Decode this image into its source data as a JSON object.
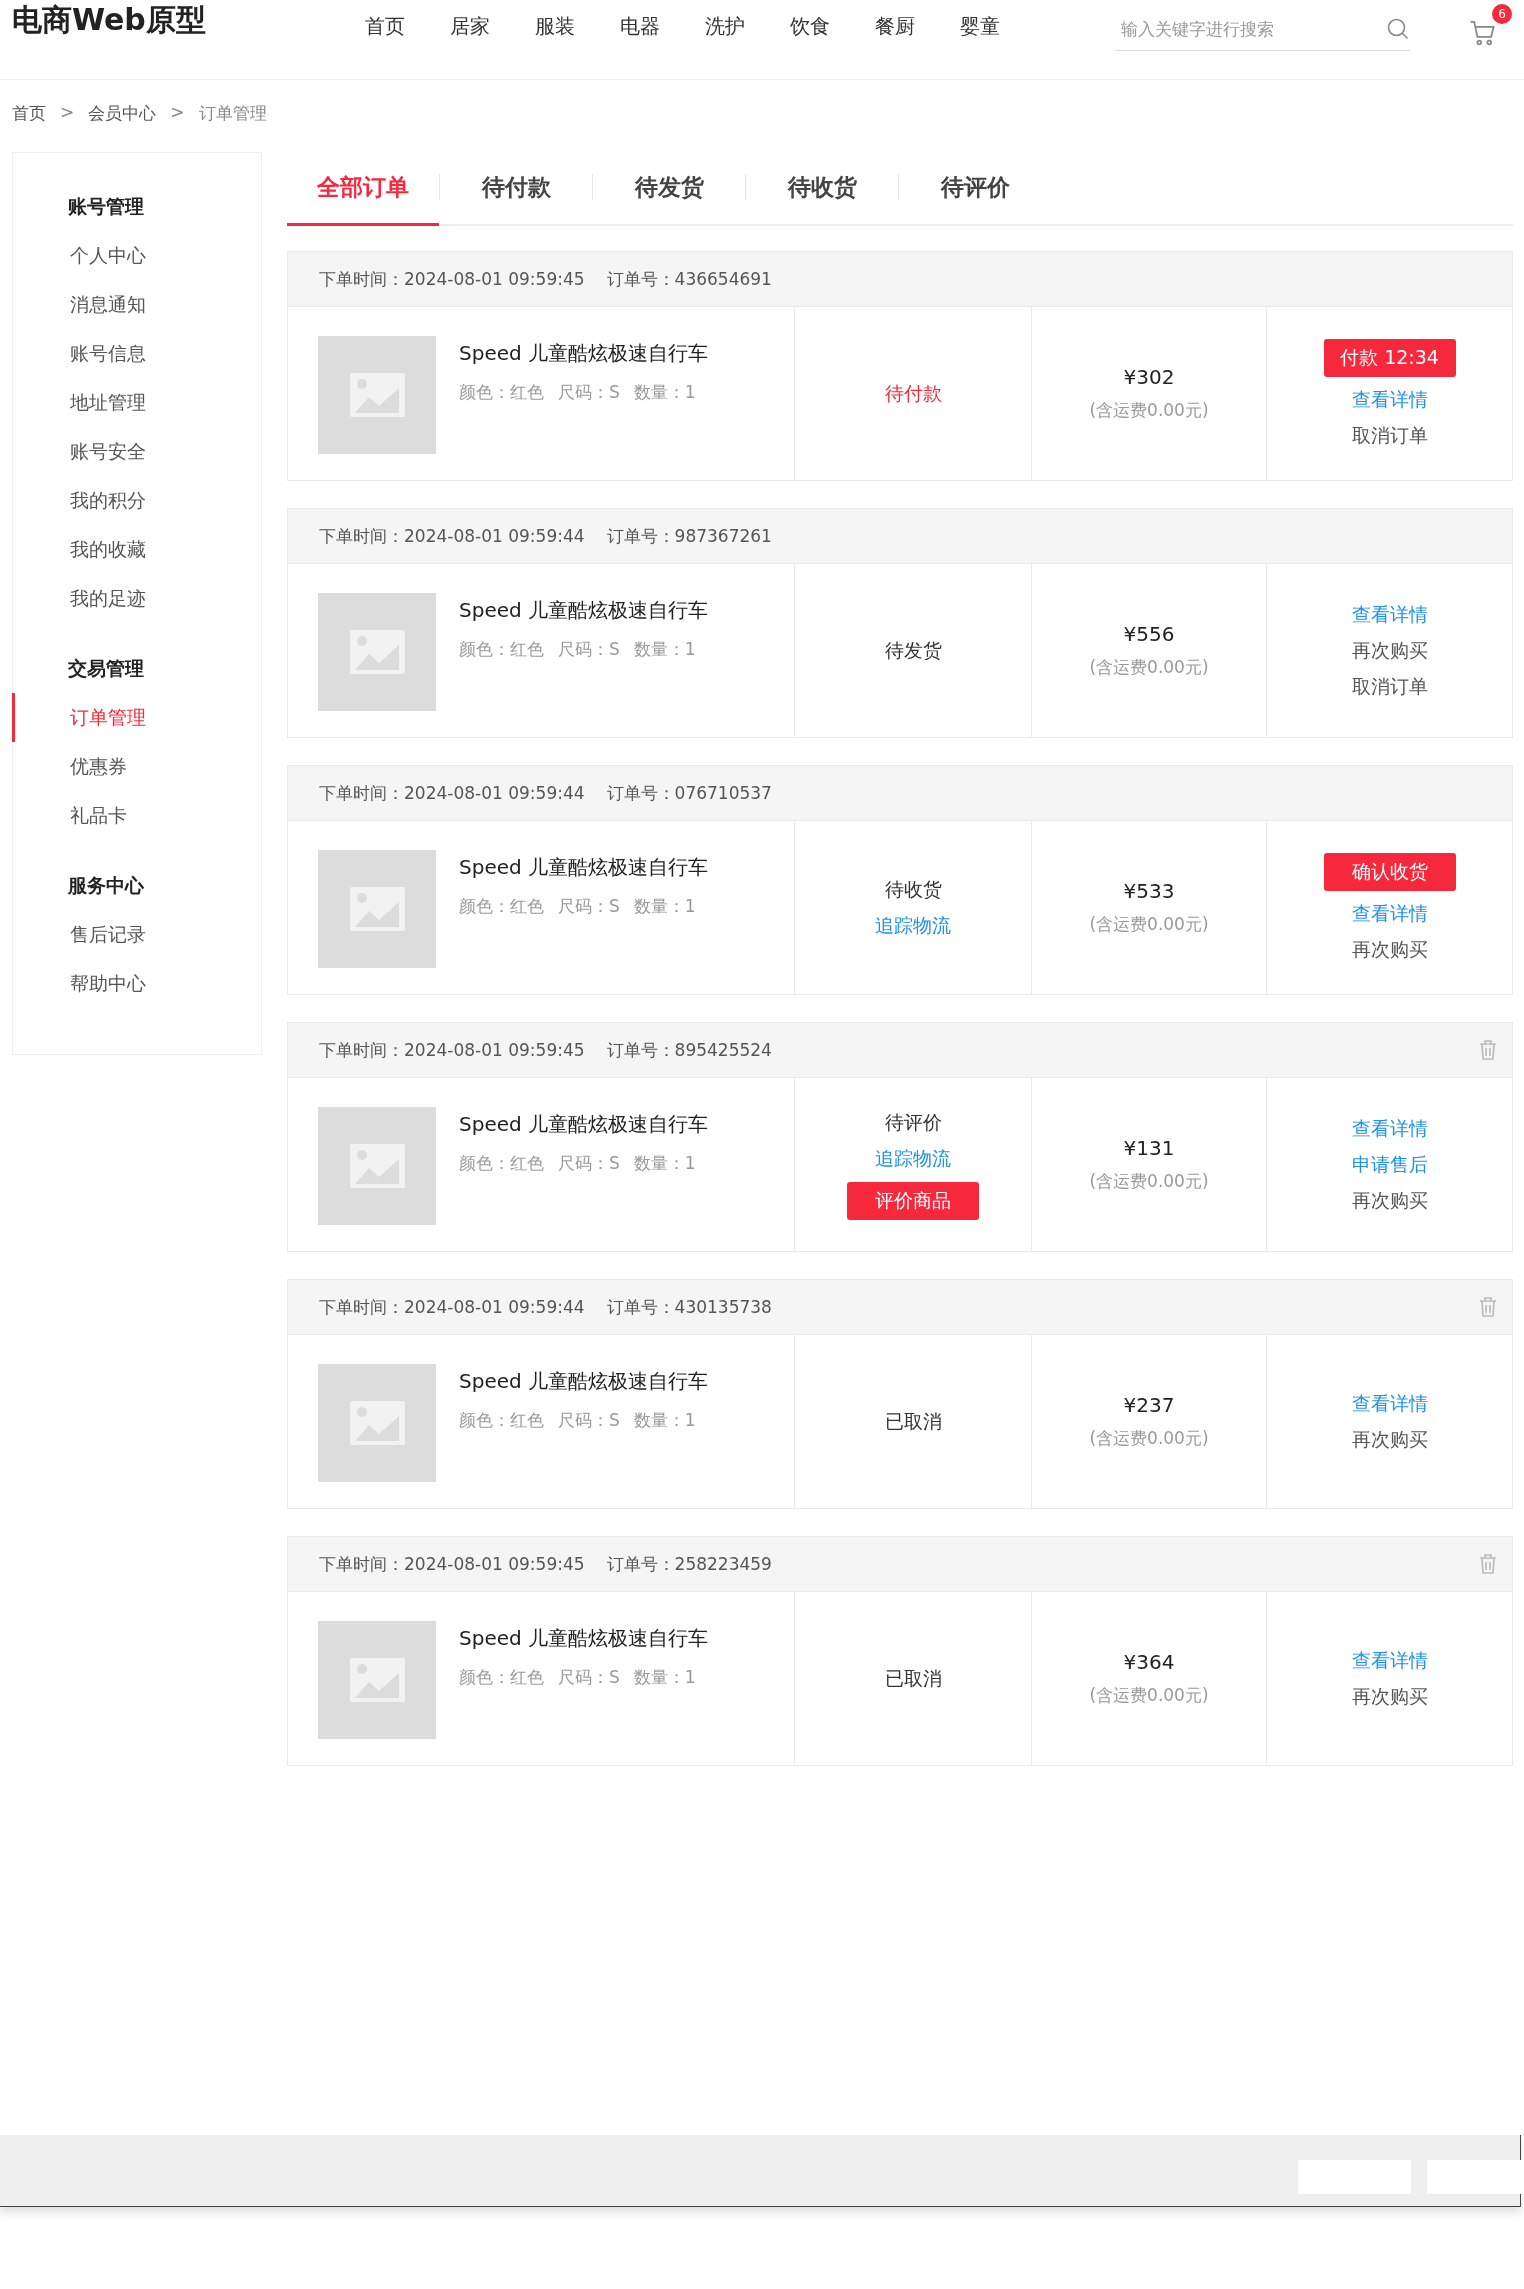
{
  "logo": "电商Web原型",
  "nav": [
    "首页",
    "居家",
    "服装",
    "电器",
    "洗护",
    "饮食",
    "餐厨",
    "婴童"
  ],
  "search": {
    "placeholder": "输入关键字进行搜索"
  },
  "cart": {
    "count": "6"
  },
  "breadcrumb": [
    {
      "label": "首页",
      "current": false
    },
    {
      "label": "会员中心",
      "current": false
    },
    {
      "label": "订单管理",
      "current": true
    }
  ],
  "breadcrumb_separator": ">",
  "sidebar": [
    {
      "title": "账号管理",
      "items": [
        {
          "label": "个人中心",
          "selected": false
        },
        {
          "label": "消息通知",
          "selected": false
        },
        {
          "label": "账号信息",
          "selected": false
        },
        {
          "label": "地址管理",
          "selected": false
        },
        {
          "label": "账号安全",
          "selected": false
        },
        {
          "label": "我的积分",
          "selected": false
        },
        {
          "label": "我的收藏",
          "selected": false
        },
        {
          "label": "我的足迹",
          "selected": false
        }
      ]
    },
    {
      "title": "交易管理",
      "items": [
        {
          "label": "订单管理",
          "selected": true
        },
        {
          "label": "优惠券",
          "selected": false
        },
        {
          "label": "礼品卡",
          "selected": false
        }
      ]
    },
    {
      "title": "服务中心",
      "items": [
        {
          "label": "售后记录",
          "selected": false
        },
        {
          "label": "帮助中心",
          "selected": false
        }
      ]
    }
  ],
  "tabs": [
    {
      "label": "全部订单",
      "selected": true
    },
    {
      "label": "待付款",
      "selected": false
    },
    {
      "label": "待发货",
      "selected": false
    },
    {
      "label": "待收货",
      "selected": false
    },
    {
      "label": "待评价",
      "selected": false
    }
  ],
  "orders": [
    {
      "time": "下单时间：2024-08-01 09:59:45",
      "order_no": "订单号：436654691",
      "deletable": false,
      "product": "Speed 儿童酷炫极速自行车",
      "specs": [
        "颜色：红色",
        "尺码：S",
        "数量：1"
      ],
      "status": "待付款",
      "status_alert": true,
      "price": "¥302",
      "shipping": "(含运费0.00元)",
      "actions": [
        {
          "label": "付款 12:34",
          "kind": "primary"
        },
        {
          "label": "查看详情",
          "kind": "link"
        },
        {
          "label": "取消订单",
          "kind": "plain"
        }
      ]
    },
    {
      "time": "下单时间：2024-08-01 09:59:44",
      "order_no": "订单号：987367261",
      "deletable": false,
      "product": "Speed 儿童酷炫极速自行车",
      "specs": [
        "颜色：红色",
        "尺码：S",
        "数量：1"
      ],
      "status": "待发货",
      "status_alert": false,
      "price": "¥556",
      "shipping": "(含运费0.00元)",
      "actions": [
        {
          "label": "查看详情",
          "kind": "link"
        },
        {
          "label": "再次购买",
          "kind": "plain"
        },
        {
          "label": "取消订单",
          "kind": "plain"
        }
      ]
    },
    {
      "time": "下单时间：2024-08-01 09:59:44",
      "order_no": "订单号：076710537",
      "deletable": false,
      "product": "Speed 儿童酷炫极速自行车",
      "specs": [
        "颜色：红色",
        "尺码：S",
        "数量：1"
      ],
      "status": "待收货",
      "status_alert": false,
      "status_links": [
        {
          "label": "追踪物流",
          "kind": "link"
        }
      ],
      "price": "¥533",
      "shipping": "(含运费0.00元)",
      "actions": [
        {
          "label": "确认收货",
          "kind": "primary"
        },
        {
          "label": "查看详情",
          "kind": "link"
        },
        {
          "label": "再次购买",
          "kind": "plain"
        }
      ]
    },
    {
      "time": "下单时间：2024-08-01 09:59:45",
      "order_no": "订单号：895425524",
      "deletable": true,
      "product": "Speed 儿童酷炫极速自行车",
      "specs": [
        "颜色：红色",
        "尺码：S",
        "数量：1"
      ],
      "status": "待评价",
      "status_alert": false,
      "status_links": [
        {
          "label": "追踪物流",
          "kind": "link"
        },
        {
          "label": "评价商品",
          "kind": "primary"
        }
      ],
      "price": "¥131",
      "shipping": "(含运费0.00元)",
      "actions": [
        {
          "label": "查看详情",
          "kind": "link"
        },
        {
          "label": "申请售后",
          "kind": "link"
        },
        {
          "label": "再次购买",
          "kind": "plain"
        }
      ]
    },
    {
      "time": "下单时间：2024-08-01 09:59:44",
      "order_no": "订单号：430135738",
      "deletable": true,
      "product": "Speed 儿童酷炫极速自行车",
      "specs": [
        "颜色：红色",
        "尺码：S",
        "数量：1"
      ],
      "status": "已取消",
      "status_alert": false,
      "price": "¥237",
      "shipping": "(含运费0.00元)",
      "actions": [
        {
          "label": "查看详情",
          "kind": "link"
        },
        {
          "label": "再次购买",
          "kind": "plain"
        }
      ]
    },
    {
      "time": "下单时间：2024-08-01 09:59:45",
      "order_no": "订单号：258223459",
      "deletable": true,
      "product": "Speed 儿童酷炫极速自行车",
      "specs": [
        "颜色：红色",
        "尺码：S",
        "数量：1"
      ],
      "status": "已取消",
      "status_alert": false,
      "price": "¥364",
      "shipping": "(含运费0.00元)",
      "actions": [
        {
          "label": "查看详情",
          "kind": "link"
        },
        {
          "label": "再次购买",
          "kind": "plain"
        }
      ]
    }
  ]
}
